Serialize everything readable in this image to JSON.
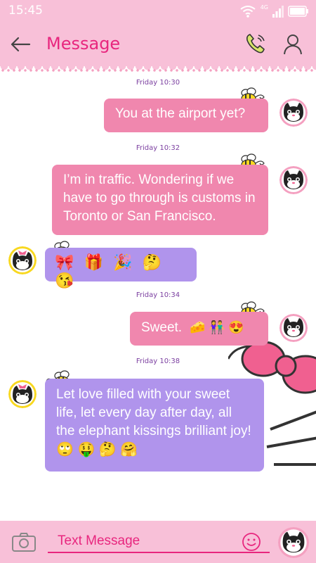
{
  "status_bar": {
    "time": "15:45",
    "network": "4G",
    "icons": [
      "wifi-icon",
      "signal-icon",
      "battery-icon"
    ]
  },
  "app_bar": {
    "title": "Message",
    "icons": [
      "back-arrow-icon",
      "phone-call-icon",
      "contact-person-icon"
    ]
  },
  "messages": [
    {
      "type": "timestamp",
      "text": "Friday 10:30"
    },
    {
      "type": "outgoing",
      "text": "You at the airport yet?"
    },
    {
      "type": "timestamp",
      "text": "Friday 10:32"
    },
    {
      "type": "outgoing",
      "text": "I’m in traffic. Wondering if we have to go through is customs in Toronto or San Francisco."
    },
    {
      "type": "incoming",
      "emojis": "🎀 🎁 🎉 🤔 😘"
    },
    {
      "type": "timestamp",
      "text": "Friday 10:34"
    },
    {
      "type": "outgoing",
      "text": "Sweet.",
      "emojis": "🧀 👫 😍"
    },
    {
      "type": "timestamp",
      "text": "Friday 10:38"
    },
    {
      "type": "incoming",
      "text": "Let love filled with your sweet life, let every day after day, all the elephant kissings brilliant joy!",
      "emojis": "🙄 🤑 🤔 🤗"
    }
  ],
  "colors": {
    "header_pink": "#f8c0d8",
    "accent": "#e8267e",
    "outgoing_bubble": "#f087ae",
    "incoming_bubble": "#b094ec",
    "timestamp": "#7b3fa0"
  },
  "composer": {
    "placeholder": "Text Message",
    "icons": [
      "camera-icon",
      "smiley-icon",
      "send-avatar"
    ]
  }
}
